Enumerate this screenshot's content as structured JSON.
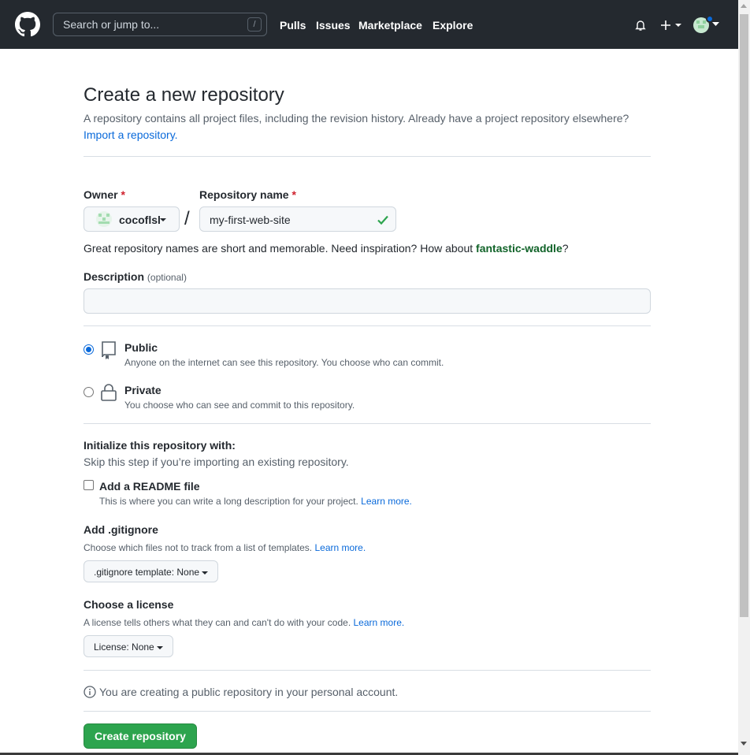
{
  "header": {
    "search_placeholder": "Search or jump to...",
    "search_shortcut": "/",
    "nav": [
      "Pulls",
      "Issues",
      "Marketplace",
      "Explore"
    ]
  },
  "page": {
    "title": "Create a new repository",
    "subtitle": "A repository contains all project files, including the revision history. Already have a project repository elsewhere?",
    "import_link": "Import a repository."
  },
  "form": {
    "owner_label": "Owner",
    "required_mark": "*",
    "owner_value": "cocoflsl",
    "separator": "/",
    "repo_label": "Repository name",
    "repo_value": "my-first-web-site",
    "name_hint": "Great repository names are short and memorable. Need inspiration? How about",
    "name_suggestion": "fantastic-waddle",
    "name_hint_end": "?",
    "description_label": "Description",
    "description_optional": "(optional)",
    "description_value": ""
  },
  "visibility": {
    "public_label": "Public",
    "public_desc": "Anyone on the internet can see this repository. You choose who can commit.",
    "private_label": "Private",
    "private_desc": "You choose who can see and commit to this repository.",
    "selected": "public"
  },
  "init": {
    "heading": "Initialize this repository with:",
    "sub": "Skip this step if you’re importing an existing repository.",
    "readme_label": "Add a README file",
    "readme_desc": "This is where you can write a long description for your project.",
    "learn_more": "Learn more.",
    "gitignore_heading": "Add .gitignore",
    "gitignore_desc": "Choose which files not to track from a list of templates.",
    "gitignore_select": ".gitignore template: None",
    "license_heading": "Choose a license",
    "license_desc": "A license tells others what they can and can't do with your code.",
    "license_select": "License: None"
  },
  "footer": {
    "info": "You are creating a public repository in your personal account.",
    "create_button": "Create repository"
  },
  "colors": {
    "header_bg": "#24292f",
    "accent_green": "#2da44e",
    "link_blue": "#0969da",
    "suggestion_green": "#116329"
  }
}
